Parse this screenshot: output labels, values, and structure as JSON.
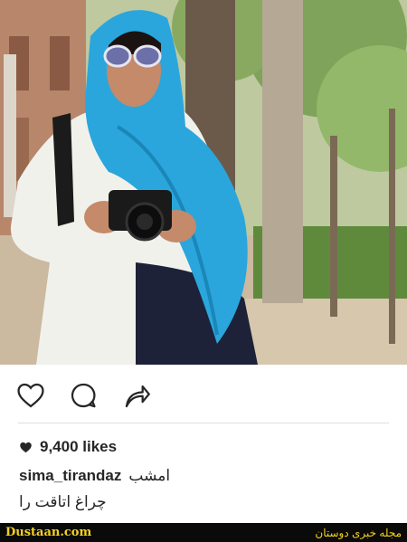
{
  "post": {
    "likes_count": "9,400 likes",
    "username": "sima_tirandaz",
    "caption_word": "امشب",
    "caption_line2": "چراغ اتاقت را"
  },
  "icons": {
    "like": "heart-outline-icon",
    "comment": "comment-bubble-icon",
    "share": "share-arrow-icon",
    "likes_heart": "heart-filled-icon"
  },
  "watermark": {
    "site": "Dustaan.com",
    "brand": "مجله خبری دوستان"
  },
  "colors": {
    "scarf_blue": "#2aa6dc",
    "footer_bg": "#0a0a0a",
    "footer_text": "#f4d21f"
  }
}
